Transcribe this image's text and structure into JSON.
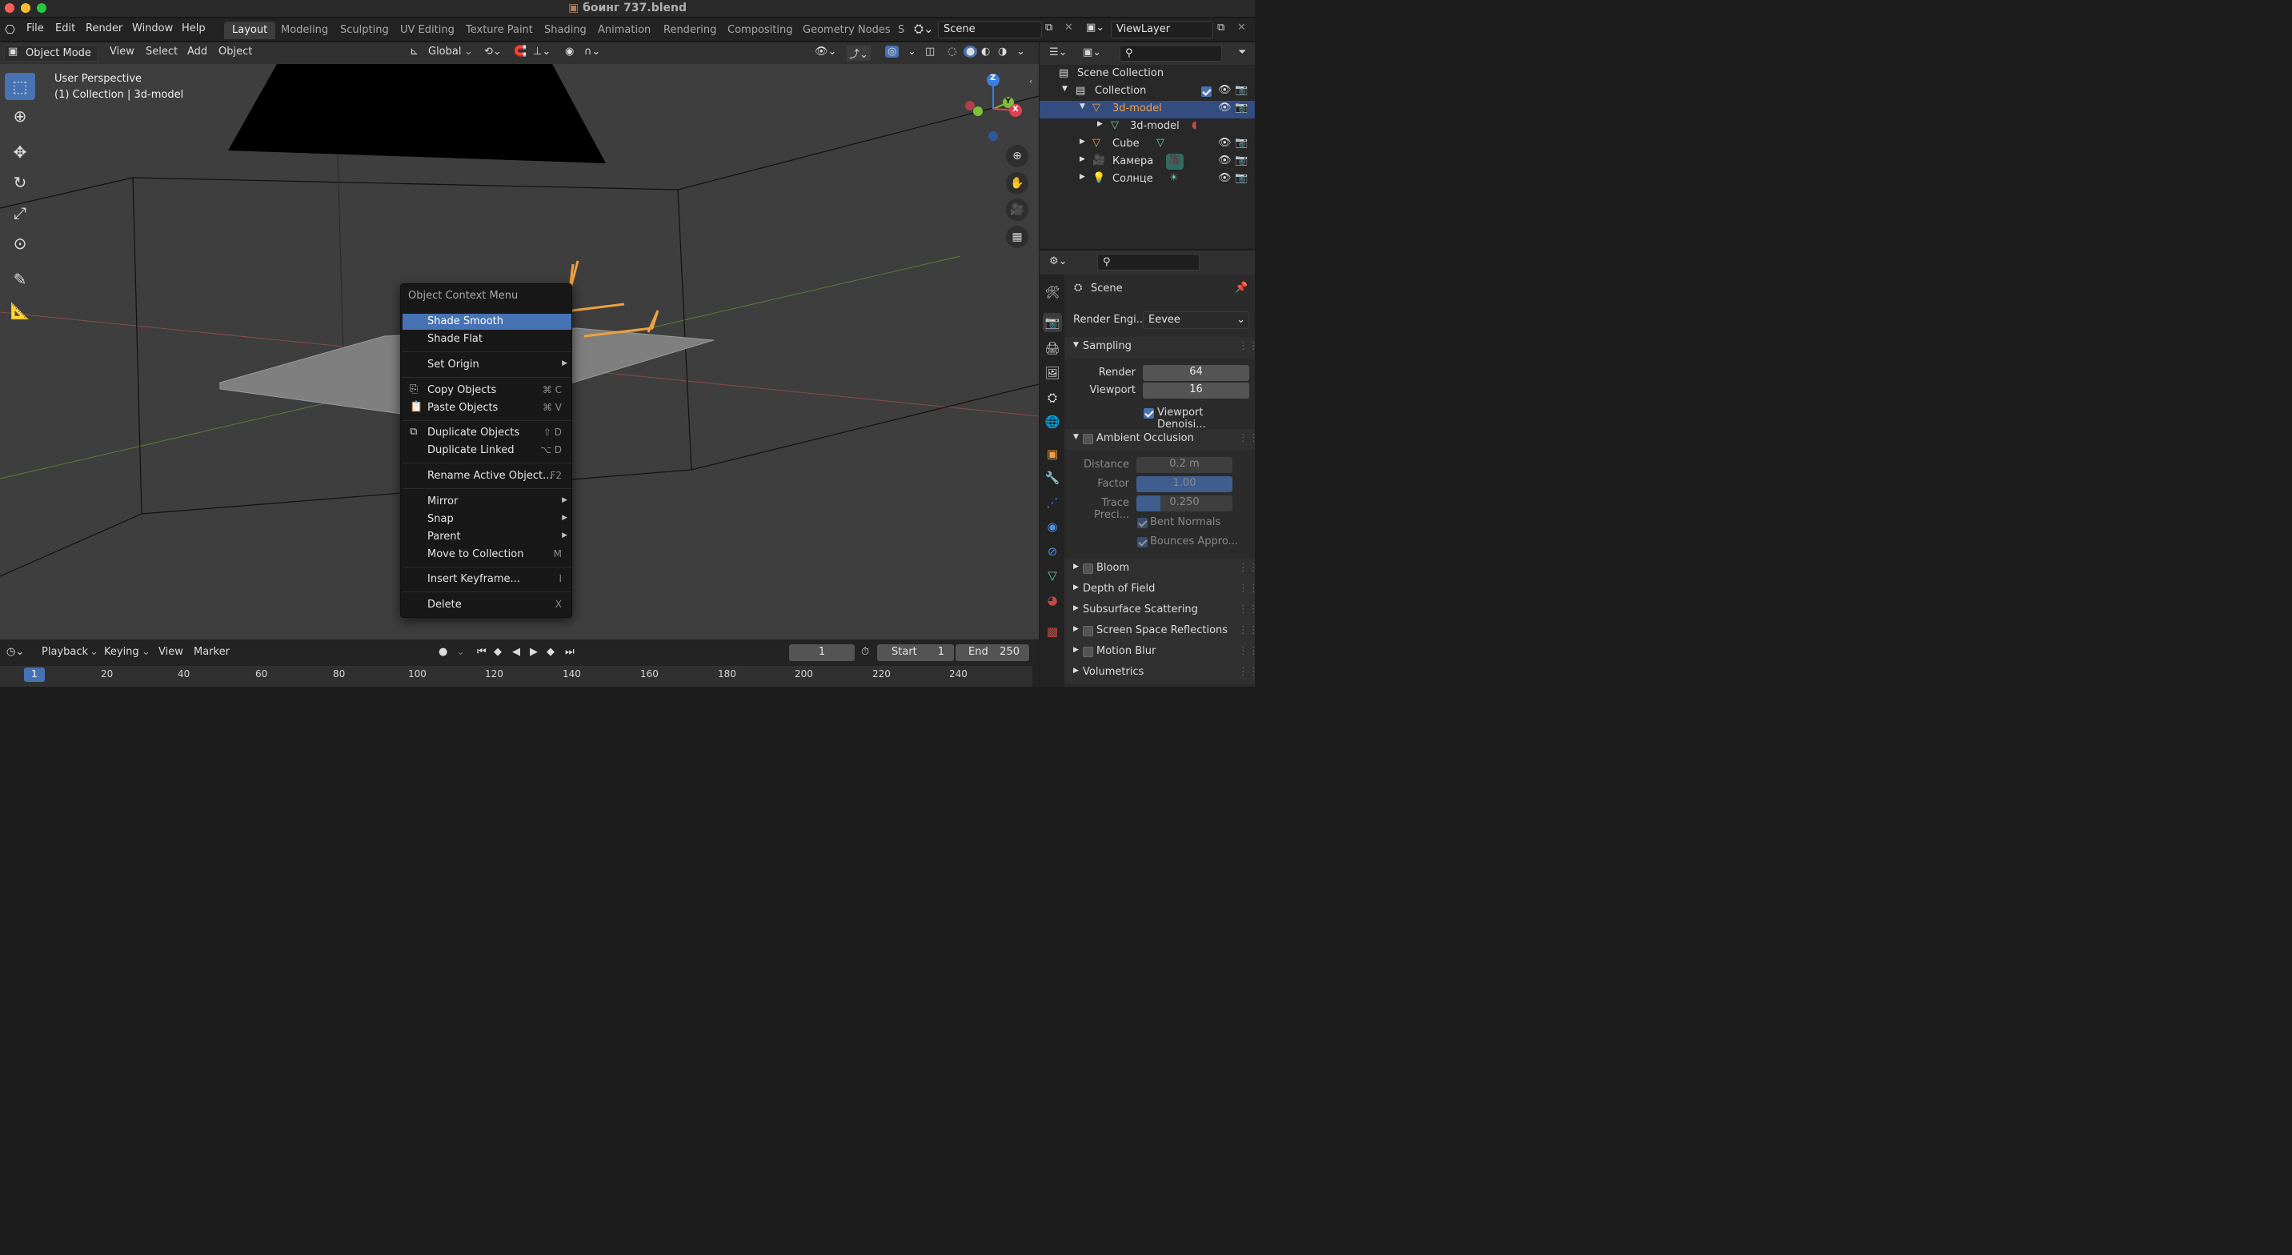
{
  "window": {
    "title": "боинг 737.blend"
  },
  "topbar": {
    "menus": [
      "File",
      "Edit",
      "Render",
      "Window",
      "Help"
    ],
    "workspaces": [
      "Layout",
      "Modeling",
      "Sculpting",
      "UV Editing",
      "Texture Paint",
      "Shading",
      "Animation",
      "Rendering",
      "Compositing",
      "Geometry Nodes",
      "S"
    ],
    "active_workspace": "Layout",
    "scene": "Scene",
    "view_layer": "ViewLayer"
  },
  "viewport": {
    "mode": "Object Mode",
    "menus": [
      "View",
      "Select",
      "Add",
      "Object"
    ],
    "transform_orientation": "Global",
    "overlay_perspective": "User Perspective",
    "overlay_collection": "(1) Collection | 3d-model",
    "gizmo_axes": {
      "z": "Z",
      "y": "Y",
      "x": "X"
    }
  },
  "context_menu": {
    "title": "Object Context Menu",
    "items": [
      {
        "label": "Shade Smooth",
        "shortcut": "",
        "submenu": false,
        "highlight": true
      },
      {
        "label": "Shade Flat",
        "shortcut": "",
        "submenu": false
      },
      {
        "label": "Set Origin",
        "shortcut": "",
        "submenu": true
      },
      {
        "label": "Copy Objects",
        "shortcut": "⌘ C",
        "submenu": false,
        "icon": "copy-icon"
      },
      {
        "label": "Paste Objects",
        "shortcut": "⌘ V",
        "submenu": false,
        "icon": "paste-icon"
      },
      {
        "label": "Duplicate Objects",
        "shortcut": "⇧ D",
        "submenu": false,
        "icon": "duplicate-icon"
      },
      {
        "label": "Duplicate Linked",
        "shortcut": "⌥ D",
        "submenu": false
      },
      {
        "label": "Rename Active Object...",
        "shortcut": "F2",
        "submenu": false
      },
      {
        "label": "Mirror",
        "shortcut": "",
        "submenu": true
      },
      {
        "label": "Snap",
        "shortcut": "",
        "submenu": true
      },
      {
        "label": "Parent",
        "shortcut": "",
        "submenu": true
      },
      {
        "label": "Move to Collection",
        "shortcut": "M",
        "submenu": false
      },
      {
        "label": "Insert Keyframe...",
        "shortcut": "I",
        "submenu": false
      },
      {
        "label": "Delete",
        "shortcut": "X",
        "submenu": false
      }
    ]
  },
  "timeline": {
    "menus": [
      "Playback",
      "Keying",
      "View",
      "Marker"
    ],
    "current_frame": "1",
    "start_label": "Start",
    "start": "1",
    "end_label": "End",
    "end": "250",
    "ruler": [
      "1",
      "20",
      "40",
      "60",
      "80",
      "100",
      "120",
      "140",
      "160",
      "180",
      "200",
      "220",
      "240"
    ]
  },
  "outliner": {
    "rows": [
      {
        "label": "Scene Collection",
        "indent": 0
      },
      {
        "label": "Collection",
        "indent": 1
      },
      {
        "label": "3d-model",
        "indent": 2,
        "selected": true
      },
      {
        "label": "3d-model",
        "indent": 3
      },
      {
        "label": "Cube",
        "indent": 2
      },
      {
        "label": "Камера",
        "indent": 2
      },
      {
        "label": "Солнце",
        "indent": 2
      }
    ]
  },
  "properties": {
    "context": "Scene",
    "render_engine_label": "Render Engi...",
    "render_engine": "Eevee",
    "sampling": {
      "header": "Sampling",
      "render_label": "Render",
      "render": "64",
      "viewport_label": "Viewport",
      "viewport": "16",
      "denoise_label": "Viewport Denoisi..."
    },
    "ao": {
      "header": "Ambient Occlusion",
      "distance_label": "Distance",
      "distance": "0.2 m",
      "factor_label": "Factor",
      "factor": "1.00",
      "factor_fill": 1.0,
      "trace_label": "Trace Preci...",
      "trace": "0.250",
      "trace_fill": 0.25,
      "bent_label": "Bent Normals",
      "bounces_label": "Bounces Appro..."
    },
    "panels": [
      "Bloom",
      "Depth of Field",
      "Subsurface Scattering",
      "Screen Space Reflections",
      "Motion Blur",
      "Volumetrics"
    ],
    "panels_checkbox": [
      true,
      false,
      false,
      true,
      true,
      false
    ]
  },
  "colors": {
    "accent": "#4772b3",
    "selected_row": "#334d80",
    "orange": "#f0a040"
  }
}
